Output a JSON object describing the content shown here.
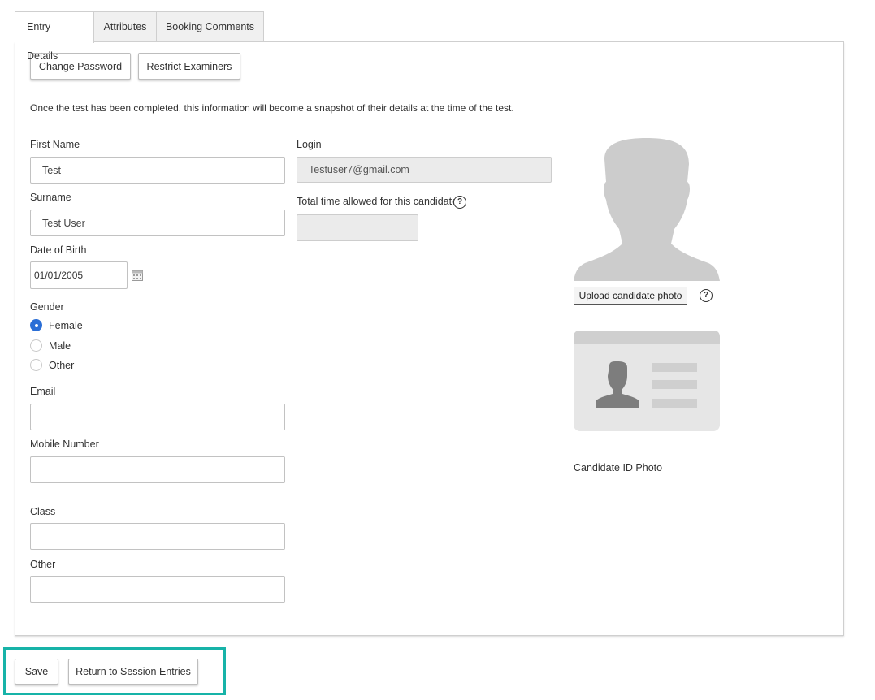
{
  "tabs": [
    {
      "label": "Entry Details",
      "active": true
    },
    {
      "label": "Attributes",
      "active": false
    },
    {
      "label": "Booking Comments",
      "active": false
    }
  ],
  "actions": {
    "change_password": "Change Password",
    "restrict_examiners": "Restrict Examiners"
  },
  "note": "Once the test has been completed, this information will become a snapshot of their details at the time of the test.",
  "form": {
    "first_name": {
      "label": "First Name",
      "value": "Test"
    },
    "surname": {
      "label": "Surname",
      "value": "Test User"
    },
    "dob": {
      "label": "Date of Birth",
      "value": "01/01/2005"
    },
    "gender": {
      "label": "Gender",
      "options": [
        "Female",
        "Male",
        "Other"
      ],
      "selected": "Female"
    },
    "email": {
      "label": "Email",
      "value": ""
    },
    "mobile": {
      "label": "Mobile Number",
      "value": ""
    },
    "class": {
      "label": "Class",
      "value": ""
    },
    "other": {
      "label": "Other",
      "value": ""
    },
    "login": {
      "label": "Login",
      "value": "Testuser7@gmail.com"
    },
    "total_time": {
      "label": "Total time allowed for this candidate",
      "value": ""
    }
  },
  "photo": {
    "upload_label": "Upload candidate photo",
    "id_photo_label": "Candidate ID Photo",
    "help_glyph": "?"
  },
  "footer": {
    "save": "Save",
    "return": "Return to Session Entries"
  },
  "colors": {
    "highlight": "#17b3a8",
    "radio_selected": "#2a6ed6",
    "placeholder_gray": "#cccccc"
  }
}
